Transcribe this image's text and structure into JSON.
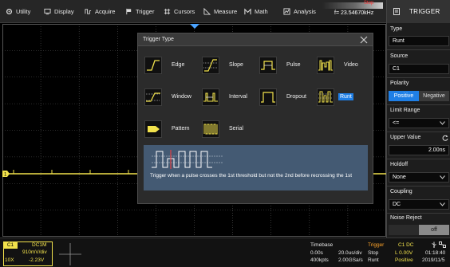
{
  "menu": {
    "utility": "Utility",
    "display": "Display",
    "acquire": "Acquire",
    "trigger": "Trigger",
    "cursors": "Cursors",
    "measure": "Measure",
    "math": "Math",
    "analysis": "Analysis"
  },
  "freq": {
    "value": "f= 23.54670kHz",
    "state": "Stop"
  },
  "panel": {
    "title": "TRIGGER",
    "type_label": "Type",
    "type_value": "Runt",
    "source_label": "Source",
    "source_value": "C1",
    "polarity_label": "Polarity",
    "polarity_on": "Positive",
    "polarity_off": "Negative",
    "limit_label": "Limit Range",
    "limit_value": "<=",
    "upper_label": "Upper Value",
    "upper_value": "2.00ns",
    "holdoff_label": "Holdoff",
    "holdoff_value": "None",
    "coupling_label": "Coupling",
    "coupling_value": "DC",
    "noise_label": "Noise Reject",
    "noise_value": "off"
  },
  "dialog": {
    "title": "Trigger Type",
    "options": [
      {
        "label": "Edge",
        "icon": "edge-icon"
      },
      {
        "label": "Slope",
        "icon": "slope-icon"
      },
      {
        "label": "Pulse",
        "icon": "pulse-icon"
      },
      {
        "label": "Video",
        "icon": "video-icon"
      },
      {
        "label": "Window",
        "icon": "window-icon"
      },
      {
        "label": "Interval",
        "icon": "interval-icon"
      },
      {
        "label": "Dropout",
        "icon": "dropout-icon"
      },
      {
        "label": "Runt",
        "icon": "runt-icon"
      },
      {
        "label": "Pattern",
        "icon": "pattern-icon"
      },
      {
        "label": "Serial",
        "icon": "serial-icon"
      }
    ],
    "selected": "Runt",
    "description": "Trigger when a pulse crosses the 1st threshold but not the 2nd before recrossing the 1st"
  },
  "channel1": {
    "tag": "C1",
    "bandwidth": "DC1M",
    "scale": "910mV/div",
    "probe": "10X",
    "offset": "-2.23V"
  },
  "timebase": {
    "label": "Timebase",
    "delay": "0.00s",
    "scale": "20.0us/div",
    "points": "400kpts",
    "rate": "2.00GSa/s"
  },
  "trigger_status": {
    "label": "Trigger",
    "source": "C1 DC",
    "state": "Stop",
    "level": "L 0.00V",
    "mode": "Runt",
    "polarity": "Positive"
  },
  "clock": {
    "time": "01:18:40",
    "date": "2019/11/5"
  },
  "colors": {
    "ch1": "#f2e24c",
    "accent": "#1f7fe6",
    "trigger": "#ffa42a",
    "stop": "#ff3535"
  }
}
